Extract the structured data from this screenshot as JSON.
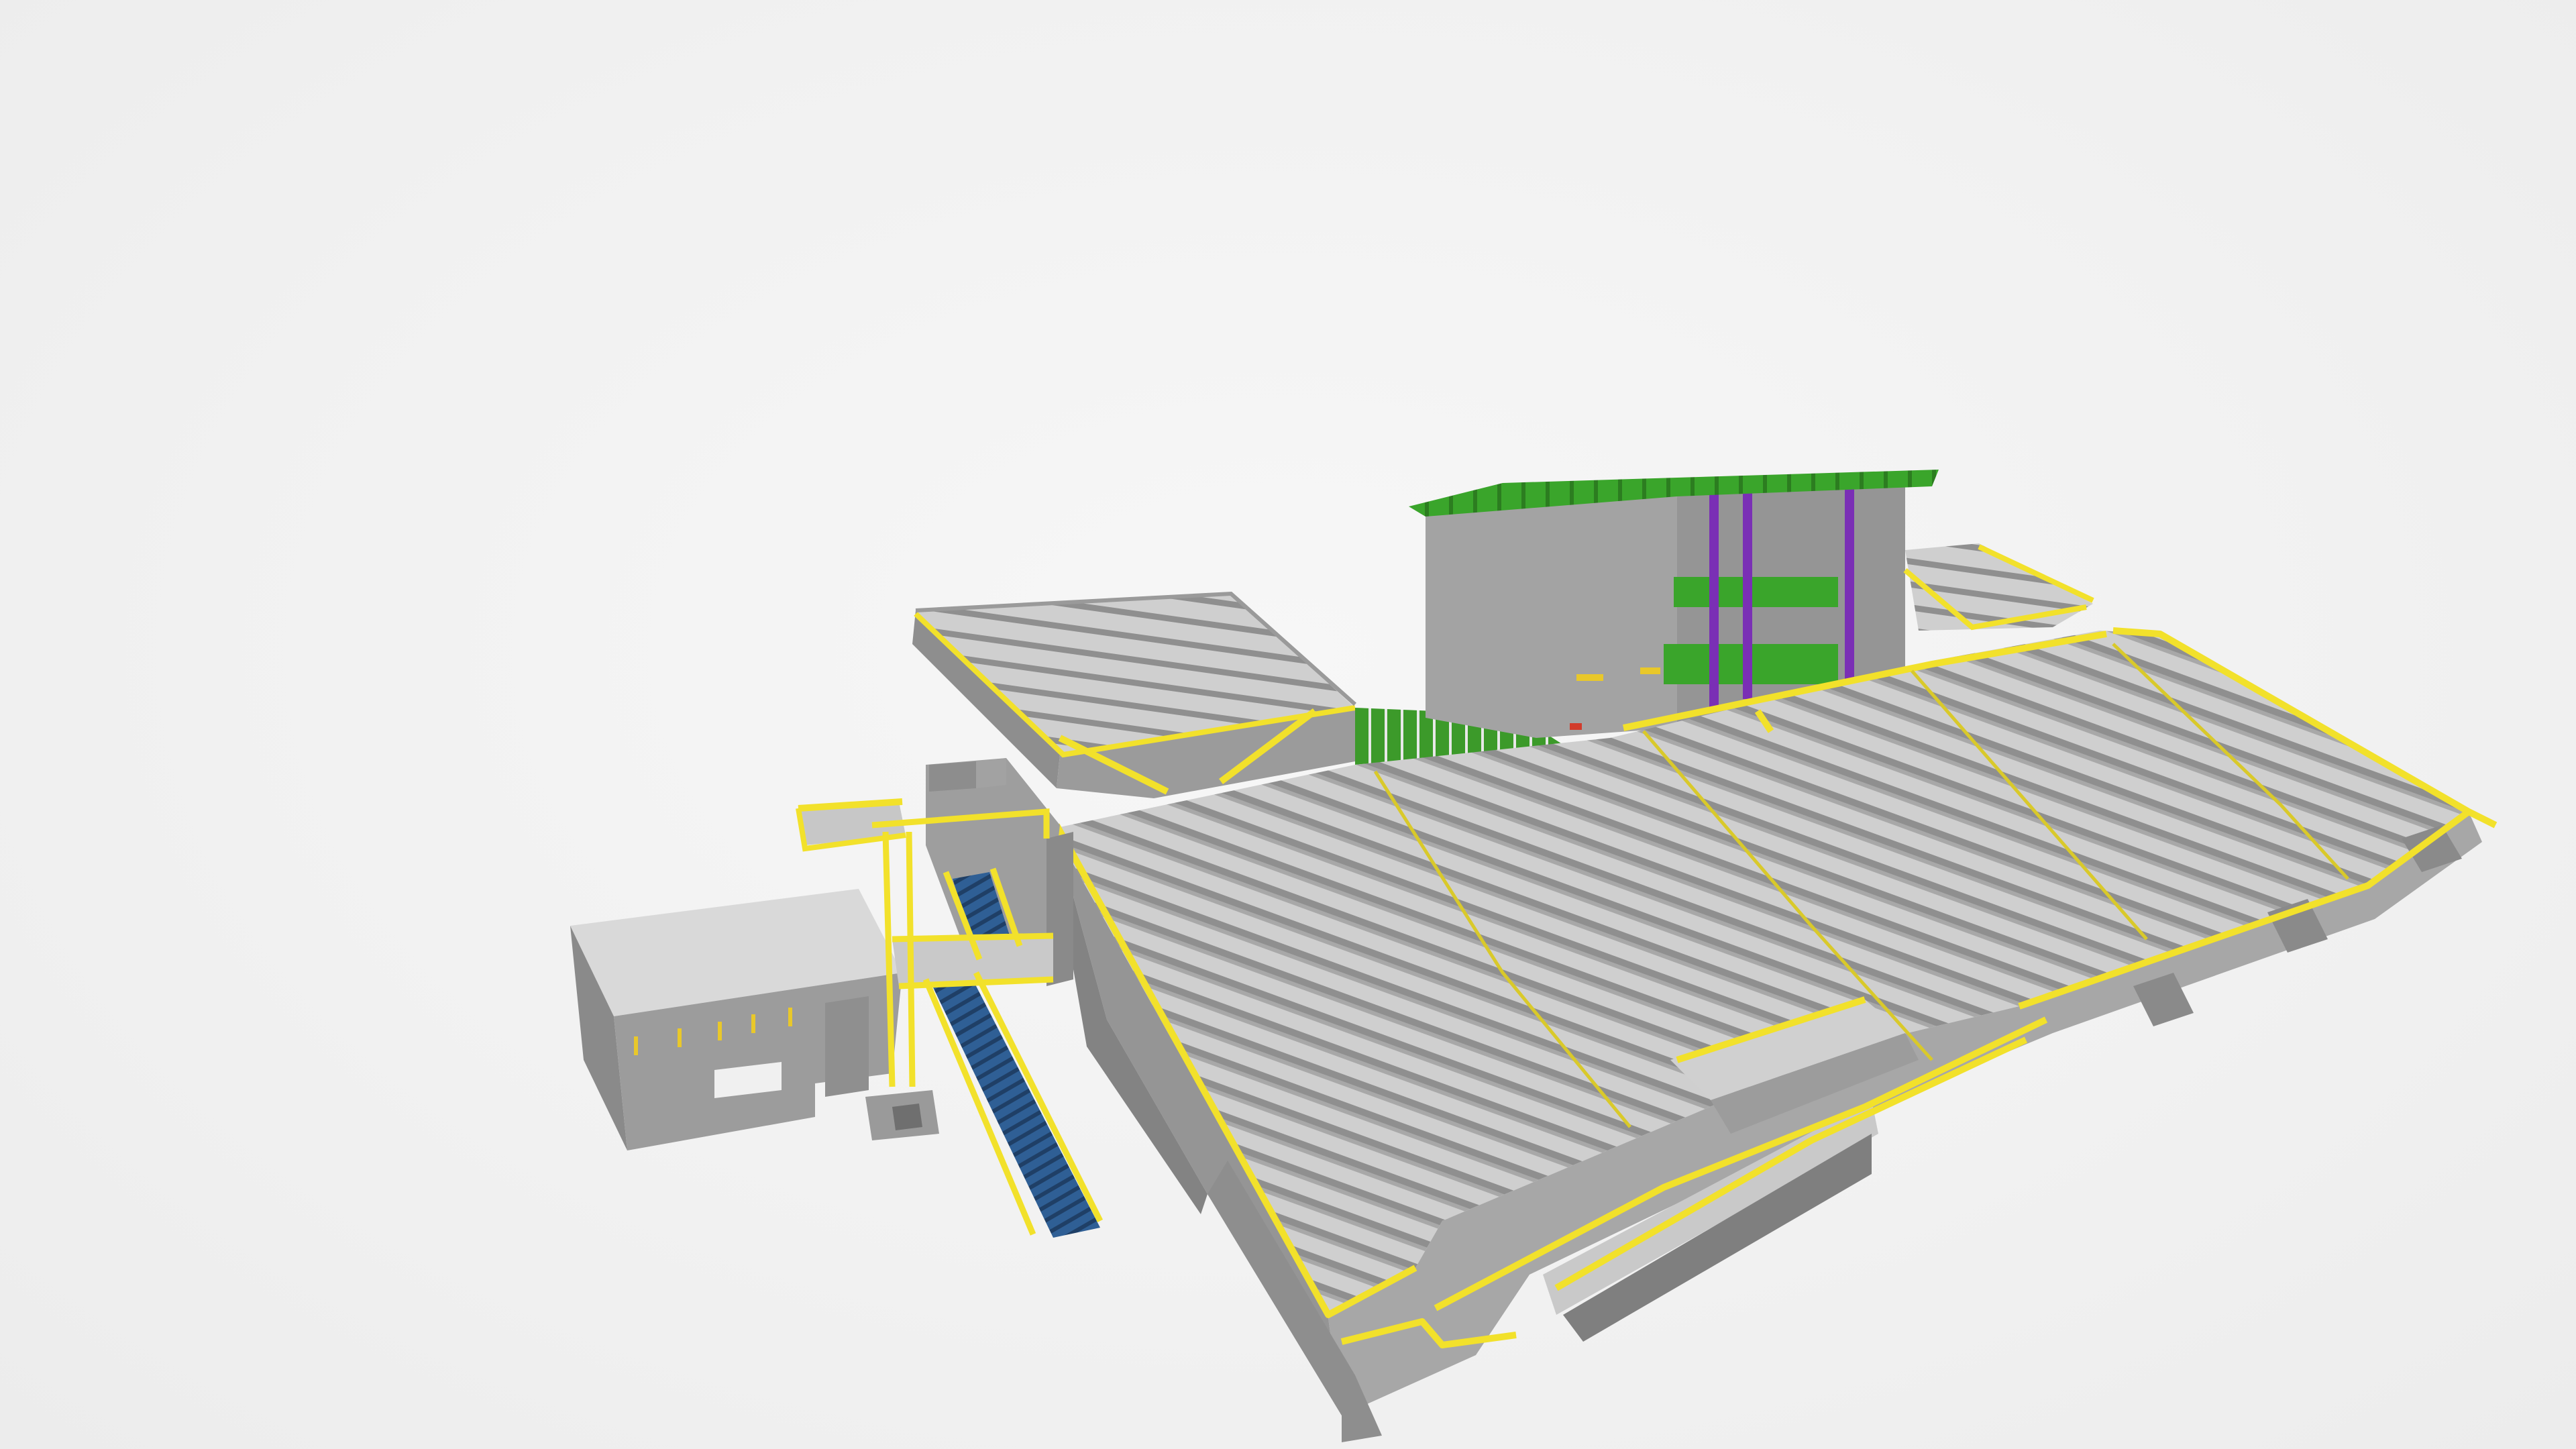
{
  "viewer": {
    "background": "#f3f3f3"
  },
  "model": {
    "palette": {
      "concrete_top": "#d6d6d6",
      "concrete_side": "#9a9a9a",
      "concrete_dark": "#7f7f7f",
      "railing": "#f2e12b",
      "railing_dark": "#c9b91b",
      "stair_tread": "#2f5f95",
      "roof_green": "#3aa52b",
      "field_green": "#3c9a2a",
      "column_purple": "#7a2fb5",
      "accent_red": "#d23b2b"
    },
    "icons": [
      "stadium-model-icon"
    ]
  }
}
